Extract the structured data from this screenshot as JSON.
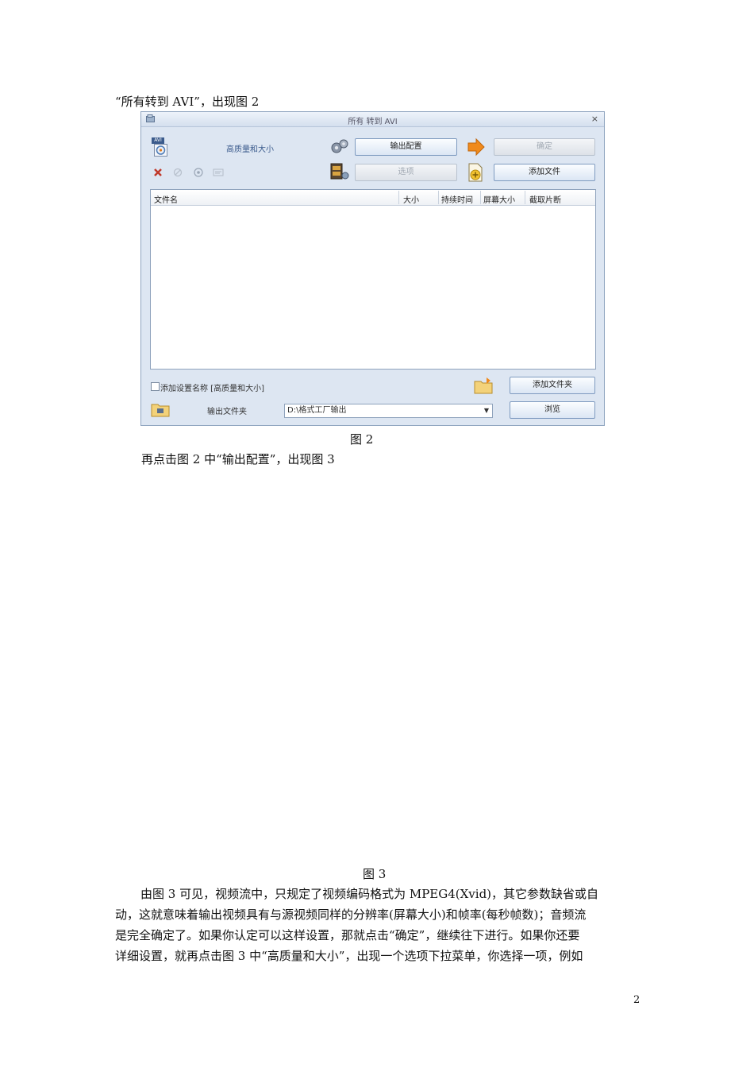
{
  "doc": {
    "intro_line": "“所有转到 AVI”，出现图 2",
    "fig2_caption": "图 2",
    "click_line": "再点击图 2 中“输出配置”，出现图 3",
    "fig3_caption": "图 3",
    "paragraph_lines": [
      "由图 3 可见，视频流中，只规定了视频编码格式为 MPEG4(Xvid)，其它参数缺省或自",
      "动，这就意味着输出视频具有与源视频同样的分辨率(屏幕大小)和帧率(每秒帧数)；音频流",
      "是完全确定了。如果你认定可以这样设置，那就点击“确定”，继续往下进行。如果你还要",
      "详细设置，就再点击图 3 中“高质量和大小”，出现一个选项下拉菜单，你选择一项，例如"
    ],
    "page_number": "2"
  },
  "dialog": {
    "title": "所有 转到 AVI",
    "close_glyph": "×",
    "avi_badge": "AVI",
    "quality_label": "高质量和大小",
    "output_config_button": "输出配置",
    "ok_button": "确定",
    "options_button": "选项",
    "add_file_button": "添加文件",
    "columns": [
      "文件名",
      "大小",
      "持续时间",
      "屏幕大小",
      "截取片断"
    ],
    "checkbox_label": "添加设置名称 [高质量和大小]",
    "add_folder_button": "添加文件夹",
    "output_folder_label": "输出文件夹",
    "output_folder_value": "D:\\格式工厂输出",
    "browse_button": "浏览"
  },
  "colors": {
    "dialog_bg": "#dde6f2",
    "arrow_orange": "#f08a1c",
    "delete_red": "#c0392b"
  }
}
